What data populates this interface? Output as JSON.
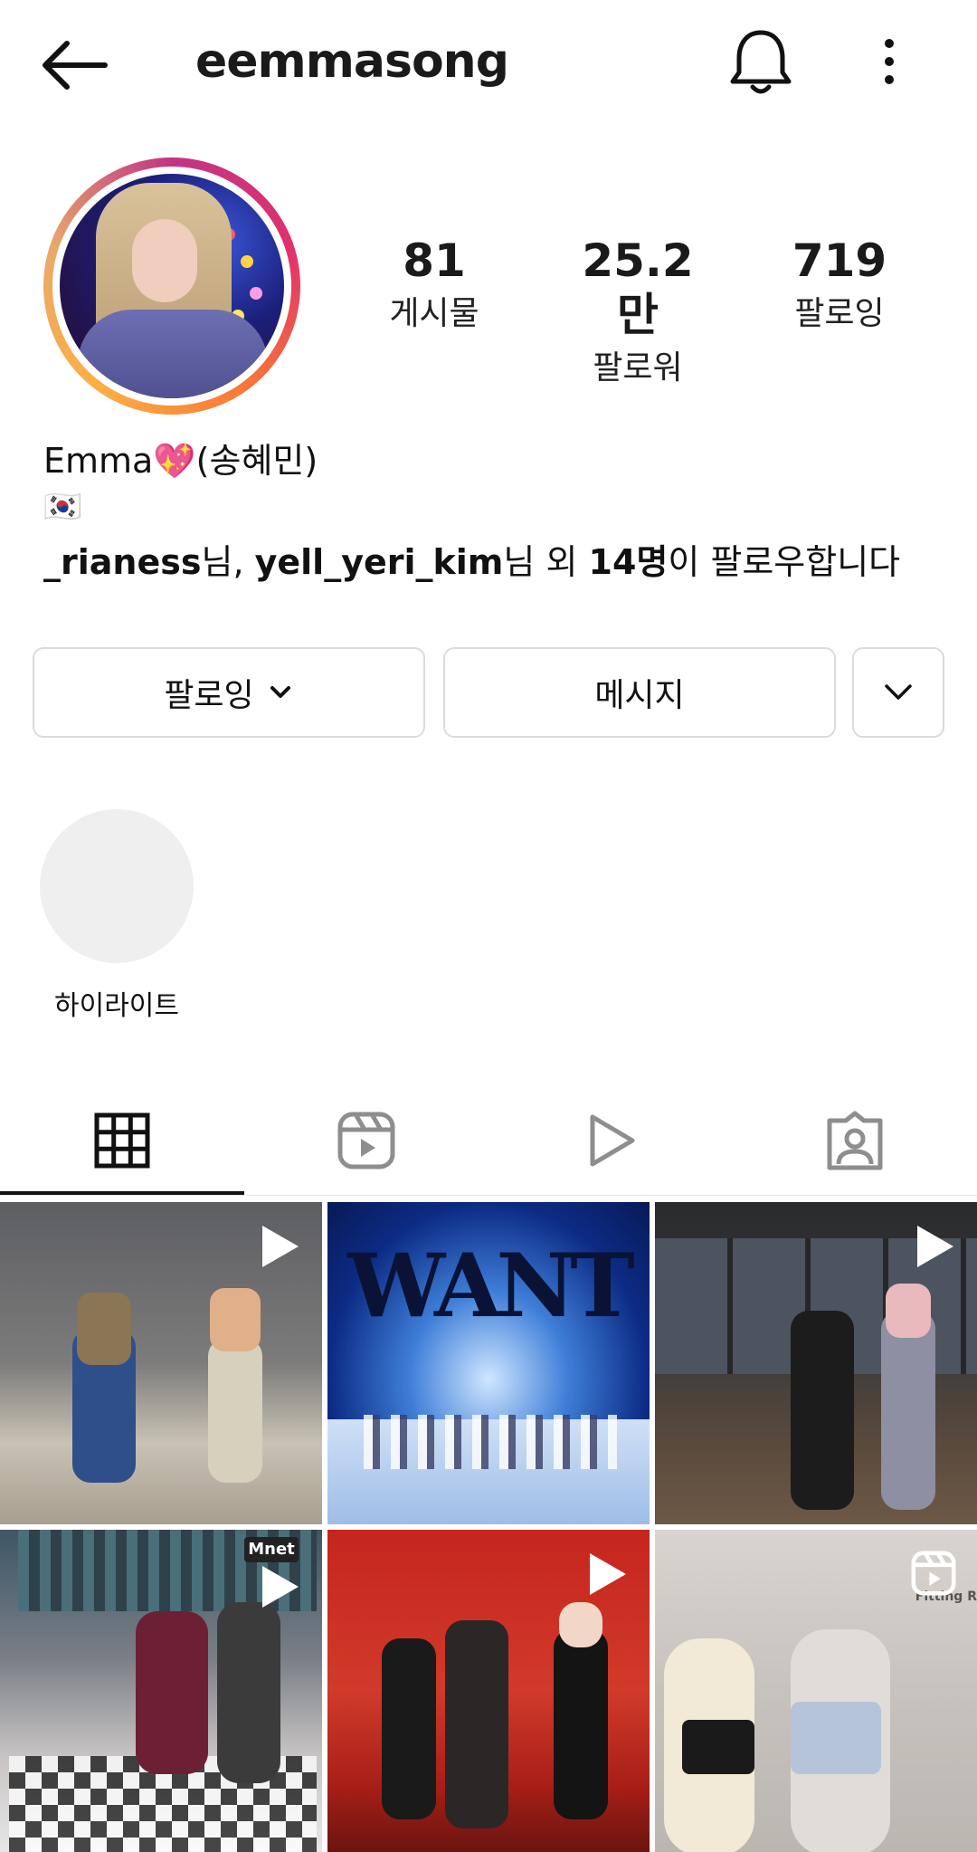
{
  "header": {
    "username": "eemmasong",
    "back_icon": "back-arrow-icon",
    "notification_icon": "bell-icon",
    "more_icon": "more-vertical-icon"
  },
  "profile": {
    "stats": [
      {
        "value": "81",
        "label": "게시물"
      },
      {
        "value": "25.2만",
        "label": "팔로워"
      },
      {
        "value": "719",
        "label": "팔로잉"
      }
    ],
    "name_prefix": "Emma",
    "name_emoji": "💖",
    "name_suffix": "(송혜민)",
    "flag": "🇰🇷",
    "followed_by": {
      "user1": "_rianess",
      "suffix1": "님, ",
      "user2": "yell_yeri_kim",
      "suffix2": "님 외 ",
      "count": "14명",
      "suffix3": "이 팔로우합니다"
    }
  },
  "actions": {
    "following_label": "팔로잉",
    "message_label": "메시지"
  },
  "highlights": {
    "label": "하이라이트"
  },
  "tabs": [
    "grid",
    "reels",
    "videos",
    "tagged"
  ],
  "grid": [
    {
      "type": "video",
      "theme": "studio-gray"
    },
    {
      "type": "image",
      "title": "WANT"
    },
    {
      "type": "video",
      "theme": "studio-dark"
    },
    {
      "type": "video",
      "badge": "Mnet"
    },
    {
      "type": "video",
      "theme": "red-wall"
    },
    {
      "type": "reel",
      "caption": "Fitting R"
    }
  ]
}
